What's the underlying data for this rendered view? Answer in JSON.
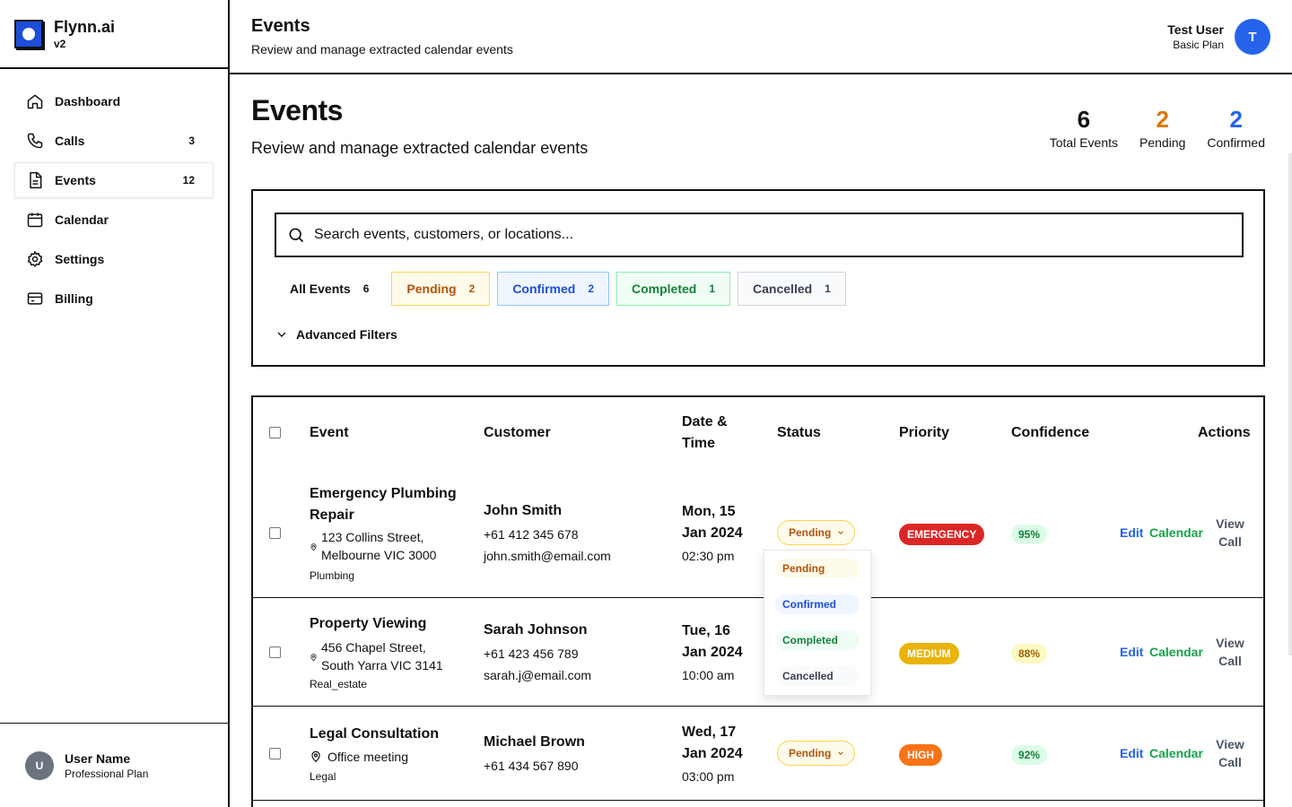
{
  "brand": {
    "name": "Flynn.ai",
    "version": "v2"
  },
  "nav": {
    "items": [
      {
        "label": "Dashboard",
        "badge": ""
      },
      {
        "label": "Calls",
        "badge": "3"
      },
      {
        "label": "Events",
        "badge": "12"
      },
      {
        "label": "Calendar",
        "badge": ""
      },
      {
        "label": "Settings",
        "badge": ""
      },
      {
        "label": "Billing",
        "badge": ""
      }
    ]
  },
  "sidebar_user": {
    "initial": "U",
    "name": "User Name",
    "plan": "Professional Plan"
  },
  "header": {
    "title": "Events",
    "subtitle": "Review and manage extracted calendar events"
  },
  "top_user": {
    "name": "Test User",
    "plan": "Basic Plan",
    "initial": "T"
  },
  "page": {
    "title": "Events",
    "subtitle": "Review and manage extracted calendar events"
  },
  "stats": [
    {
      "value": "6",
      "label": "Total Events",
      "color": "#111111"
    },
    {
      "value": "2",
      "label": "Pending",
      "color": "#d97706"
    },
    {
      "value": "2",
      "label": "Confirmed",
      "color": "#2563eb"
    }
  ],
  "search": {
    "placeholder": "Search events, customers, or locations..."
  },
  "filters": [
    {
      "label": "All Events",
      "count": "6"
    },
    {
      "label": "Pending",
      "count": "2"
    },
    {
      "label": "Confirmed",
      "count": "2"
    },
    {
      "label": "Completed",
      "count": "1"
    },
    {
      "label": "Cancelled",
      "count": "1"
    }
  ],
  "advanced_filters_label": "Advanced Filters",
  "table": {
    "headers": {
      "event": "Event",
      "customer": "Customer",
      "datetime_1": "Date &",
      "datetime_2": "Time",
      "status": "Status",
      "priority": "Priority",
      "confidence": "Confidence",
      "actions": "Actions"
    },
    "rows": [
      {
        "title_1": "Emergency Plumbing",
        "title_2": "Repair",
        "loc_1": "123 Collins Street,",
        "loc_2": "Melbourne VIC 3000",
        "category": "Plumbing",
        "customer": "John Smith",
        "phone": "+61 412 345 678",
        "email": "john.smith@email.com",
        "date_1": "Mon, 15",
        "date_2": "Jan 2024",
        "time": "02:30 pm",
        "status": "Pending",
        "priority": "EMERGENCY",
        "priority_color": "#dc2626",
        "confidence": "95%"
      },
      {
        "title_1": "Property Viewing",
        "loc_1": "456 Chapel Street,",
        "loc_2": "South Yarra VIC 3141",
        "category": "Real_estate",
        "customer": "Sarah Johnson",
        "phone": "+61 423 456 789",
        "email": "sarah.j@email.com",
        "date_1": "Tue, 16",
        "date_2": "Jan 2024",
        "time": "10:00 am",
        "priority": "MEDIUM",
        "priority_color": "#eab308",
        "confidence": "88%"
      },
      {
        "title_1": "Legal Consultation",
        "loc_1": "Office meeting",
        "category": "Legal",
        "customer": "Michael Brown",
        "phone": "+61 434 567 890",
        "date_1": "Wed, 17",
        "date_2": "Jan 2024",
        "time": "03:00 pm",
        "status": "Pending",
        "priority": "HIGH",
        "priority_color": "#f97316",
        "confidence": "92%"
      }
    ],
    "actions": {
      "edit": "Edit",
      "calendar": "Calendar",
      "view_1": "View",
      "view_2": "Call"
    }
  },
  "status_dropdown": {
    "options": [
      {
        "label": "Pending",
        "bg": "#fffbeb",
        "color": "#b45309"
      },
      {
        "label": "Confirmed",
        "bg": "#eff6ff",
        "color": "#1d4ed8"
      },
      {
        "label": "Completed",
        "bg": "#f0fdf4",
        "color": "#15803d"
      },
      {
        "label": "Cancelled",
        "bg": "#f9fafb",
        "color": "#374151"
      }
    ]
  }
}
